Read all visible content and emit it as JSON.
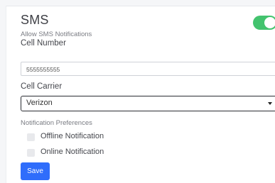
{
  "sms": {
    "title": "SMS",
    "enabled": true,
    "toggle_color": "#43c36e",
    "allow_label": "Allow SMS Notifications",
    "cell_number_label": "Cell Number",
    "cell_number_value": "5555555555",
    "carrier_label": "Cell Carrier",
    "carrier_value": "Verizon",
    "preferences_label": "Notification Preferences",
    "options": [
      {
        "label": "Offline Notification",
        "checked": false
      },
      {
        "label": "Online Notification",
        "checked": false
      }
    ],
    "save_label": "Save",
    "save_color": "#2f6dfb"
  }
}
